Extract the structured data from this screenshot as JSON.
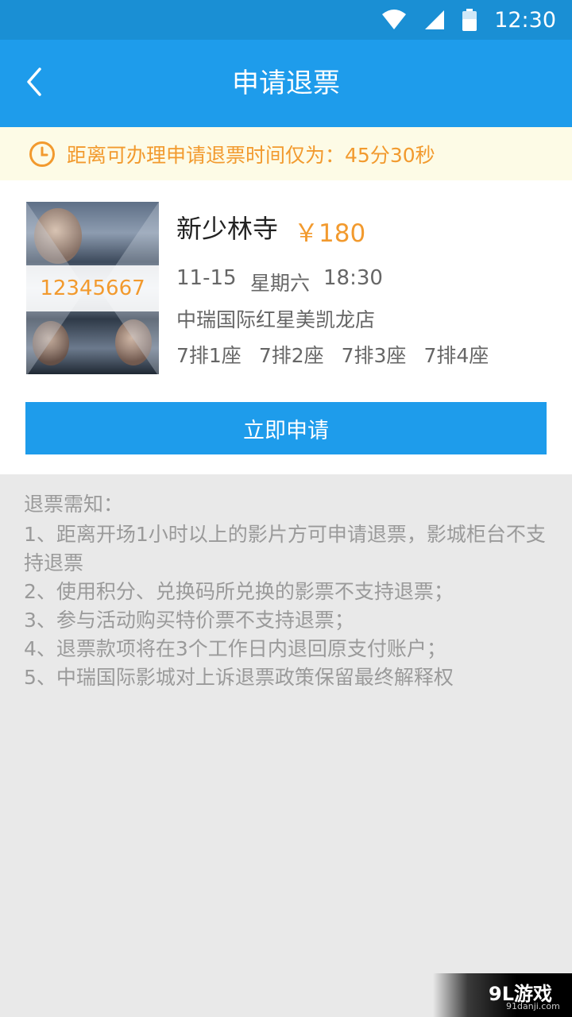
{
  "status_bar": {
    "time": "12:30",
    "icons": [
      "wifi-icon",
      "signal-icon",
      "battery-icon"
    ]
  },
  "header": {
    "title": "申请退票",
    "back_icon": "chevron-left-icon"
  },
  "notice": {
    "icon": "clock-icon",
    "text": "距离可办理申请退票时间仅为：45分30秒"
  },
  "ticket": {
    "code": "12345667",
    "movie_title": "新少林寺",
    "price": "￥180",
    "date": "11-15",
    "weekday": "星期六",
    "time": "18:30",
    "cinema": "中瑞国际红星美凯龙店",
    "seats": [
      "7排1座",
      "7排2座",
      "7排3座",
      "7排4座"
    ]
  },
  "apply_button": "立即申请",
  "rules": {
    "title": "退票需知：",
    "items": [
      "1、距离开场1小时以上的影片方可申请退票，影城柜台不支持退票",
      "2、使用积分、兑换码所兑换的影票不支持退票；",
      "3、参与活动购买特价票不支持退票；",
      "4、退票款项将在3个工作日内退回原支付账户；",
      "5、中瑞国际影城对上诉退票政策保留最终解释权"
    ]
  },
  "watermark": {
    "logo": "9L游戏",
    "site": "91danji.com"
  },
  "colors": {
    "primary": "#1e9ceb",
    "status_bar": "#1a8fd4",
    "accent": "#f29a2e",
    "notice_bg": "#fdfbe6",
    "page_bg": "#e9e9e9"
  }
}
